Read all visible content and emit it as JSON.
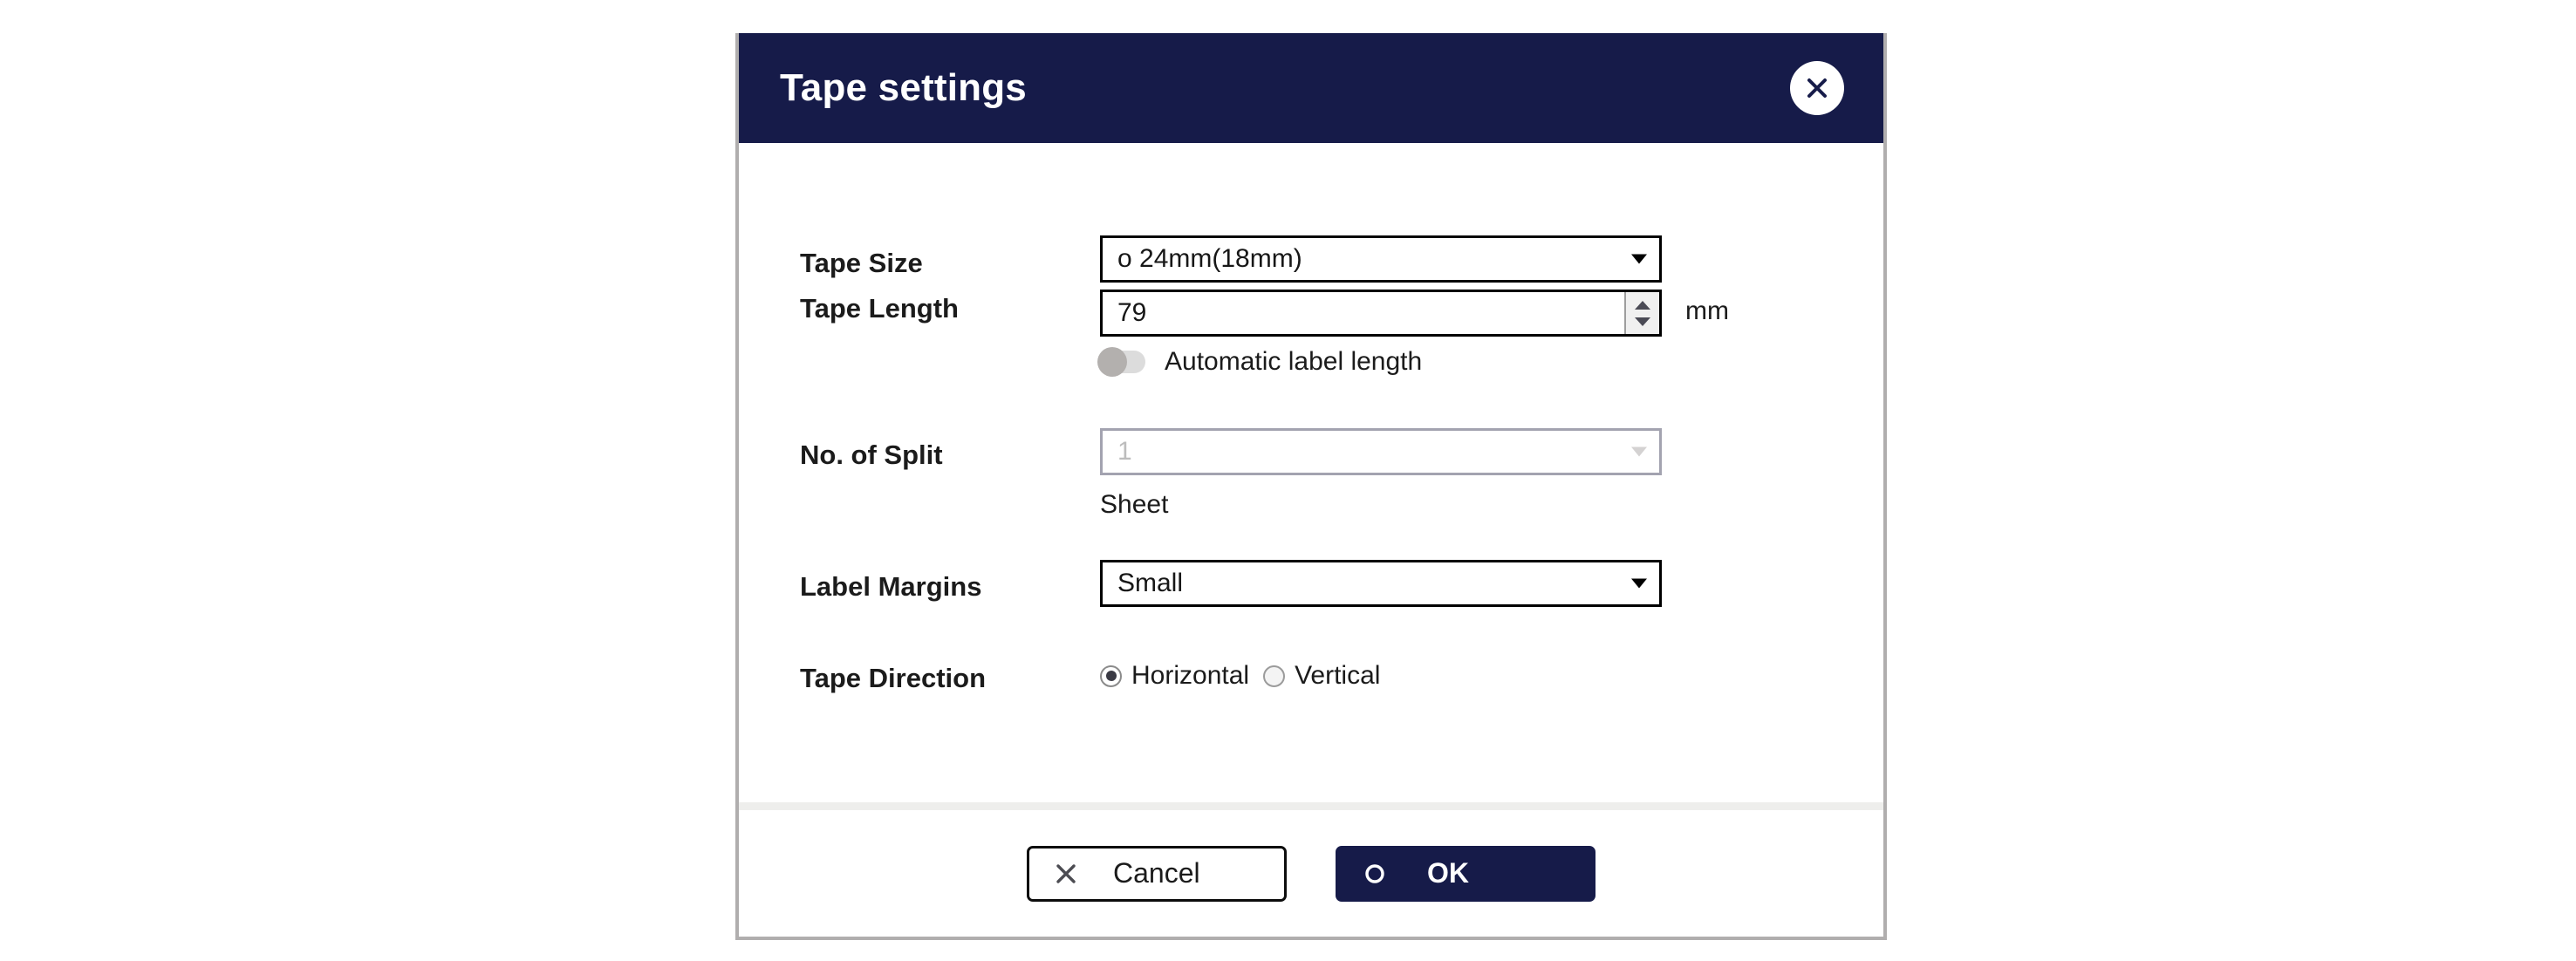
{
  "dialog": {
    "title": "Tape settings",
    "close_icon": "close-icon",
    "accent_navy": "#161B49",
    "border_gray": "#B0AEAE"
  },
  "fields": {
    "tape_size": {
      "label": "Tape Size",
      "value": "o 24mm(18mm)",
      "caret_icon": "chevron-down-icon",
      "enabled": true
    },
    "tape_length": {
      "label": "Tape Length",
      "value": "79",
      "unit": "mm",
      "spinner_up_icon": "spinner-up-icon",
      "spinner_down_icon": "spinner-down-icon",
      "enabled": true
    },
    "automatic_label_length": {
      "label": "Automatic label length",
      "state": "off"
    },
    "no_of_split": {
      "label": "No. of Split",
      "value": "1",
      "caption": "Sheet",
      "caret_icon": "chevron-down-icon",
      "enabled": false
    },
    "label_margins": {
      "label": "Label Margins",
      "value": "Small",
      "caret_icon": "chevron-down-icon",
      "enabled": true
    },
    "tape_direction": {
      "label": "Tape Direction",
      "options": [
        {
          "text": "Horizontal",
          "selected": true
        },
        {
          "text": "Vertical",
          "selected": false
        }
      ]
    }
  },
  "footer": {
    "cancel_label": "Cancel",
    "cancel_icon": "x-icon",
    "ok_label": "OK",
    "ok_icon": "circle-icon"
  }
}
